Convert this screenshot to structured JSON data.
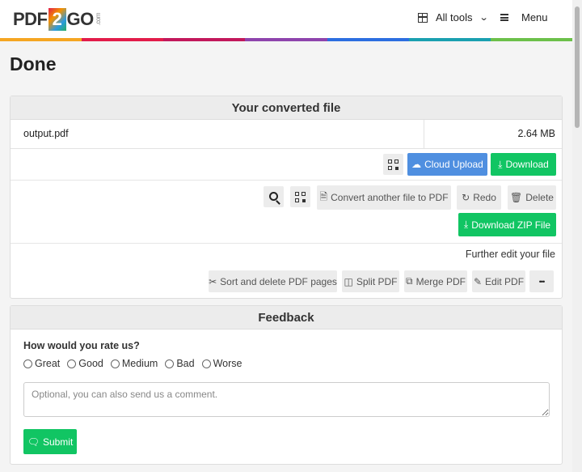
{
  "header": {
    "logo": {
      "pdf": "PDF",
      "two": "2",
      "go": "GO",
      "com": ".com"
    },
    "all_tools": "All tools",
    "menu": "Menu"
  },
  "rainbow_colors": [
    "#f5a623",
    "#e21c4a",
    "#c2185b",
    "#8e44ad",
    "#2c6ee0",
    "#1aa0b0",
    "#6cc04a"
  ],
  "page_title": "Done",
  "converted": {
    "heading": "Your converted file",
    "file_name": "output.pdf",
    "file_size": "2.64 MB",
    "cloud_upload": "Cloud Upload",
    "download": "Download",
    "convert_another": "Convert another file to PDF",
    "redo": "Redo",
    "delete": "Delete",
    "download_zip": "Download ZIP File",
    "further_edit": "Further edit your file",
    "tools": {
      "sort_delete": "Sort and delete PDF pages",
      "split": "Split PDF",
      "merge": "Merge PDF",
      "edit": "Edit PDF",
      "more": "•••"
    }
  },
  "feedback": {
    "heading": "Feedback",
    "question": "How would you rate us?",
    "ratings": [
      "Great",
      "Good",
      "Medium",
      "Bad",
      "Worse"
    ],
    "comment_placeholder": "Optional, you can also send us a comment.",
    "submit": "Submit"
  },
  "colors": {
    "green": "#11c563",
    "blue": "#4f8fe0"
  },
  "icons": [
    "grid-icon",
    "chevron-down-icon",
    "menu-icon",
    "qr-code-icon",
    "cloud-upload-icon",
    "download-icon",
    "search-icon",
    "file-icon",
    "redo-icon",
    "trash-icon",
    "scissors-icon",
    "split-icon",
    "copy-icon",
    "edit-icon",
    "more-icon",
    "comment-icon"
  ]
}
